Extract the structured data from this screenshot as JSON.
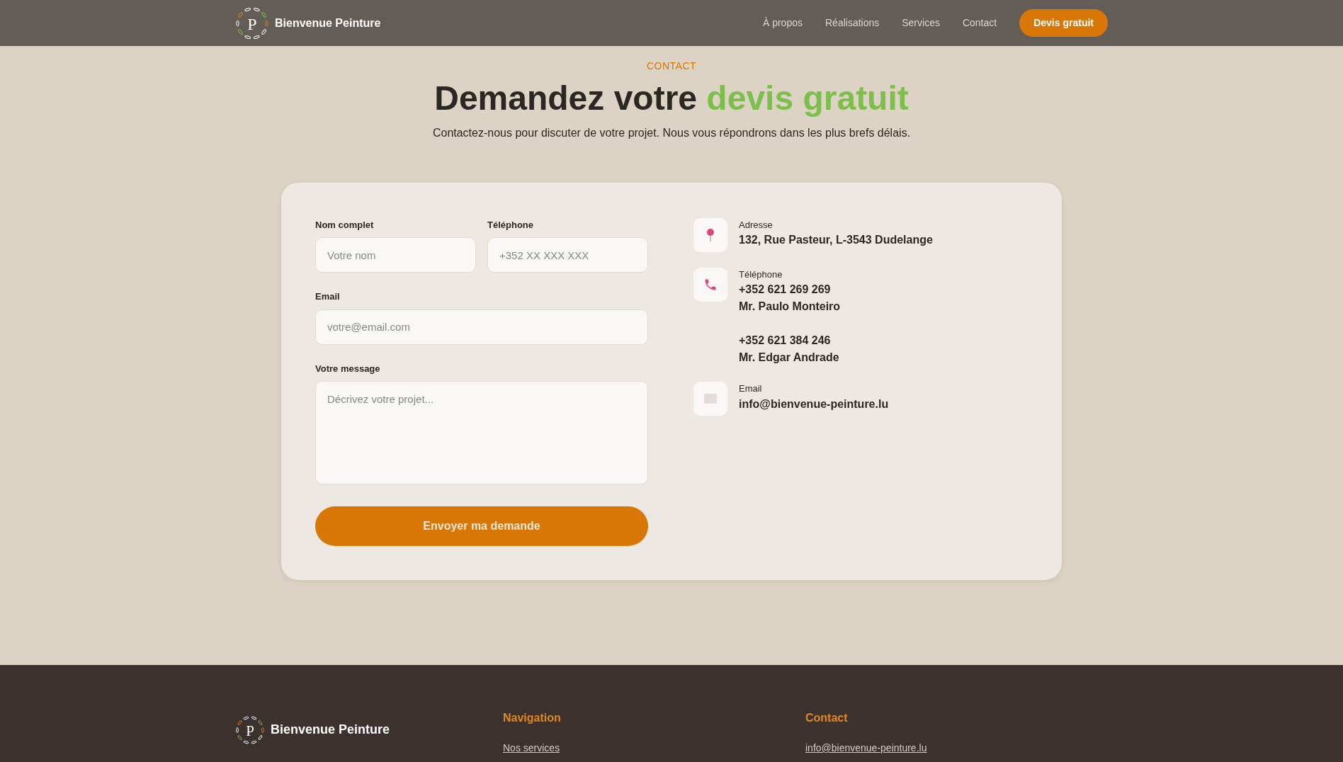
{
  "navbar": {
    "logo_letter": "P",
    "brand": "Bienvenue Peinture",
    "links": [
      "À propos",
      "Réalisations",
      "Services",
      "Contact"
    ],
    "cta": "Devis gratuit"
  },
  "section": {
    "eyebrow": "CONTACT",
    "title_start": "Demandez votre",
    "title_highlight": "devis gratuit",
    "subtitle": "Contactez-nous pour discuter de votre projet. Nous vous répondrons dans les plus brefs délais."
  },
  "form": {
    "rows": [
      [
        {
          "kind": "text",
          "label": "Nom complet",
          "placeholder": "Votre nom"
        },
        {
          "kind": "text",
          "label": "Téléphone",
          "placeholder": "+352 XX XXX XXX"
        }
      ],
      [
        {
          "kind": "text",
          "label": "Email",
          "placeholder": "votre@email.com"
        }
      ],
      [
        {
          "kind": "textarea",
          "label": "Votre message",
          "placeholder": "Décrivez votre projet..."
        }
      ]
    ],
    "submit": "Envoyer ma demande"
  },
  "contact_items": [
    {
      "kind": "address",
      "label": "Adresse",
      "entries": [
        [
          "132, Rue Pasteur, L-3543 Dudelange"
        ]
      ]
    },
    {
      "kind": "phone",
      "label": "Téléphone",
      "entries": [
        [
          "+352 621 269 269",
          "Mr. Paulo Monteiro"
        ],
        [
          "+352 621 384 246",
          "Mr. Edgar Andrade"
        ]
      ]
    },
    {
      "kind": "email",
      "label": "Email",
      "entries": [
        [
          "info@bienvenue-peinture.lu"
        ]
      ]
    }
  ],
  "footer": {
    "logo_letter": "P",
    "brand": "Bienvenue Peinture",
    "columns": [
      {
        "heading": "Navigation",
        "items": [
          "Nos services"
        ]
      },
      {
        "heading": "Contact",
        "items": [
          "info@bienvenue-peinture.lu"
        ]
      }
    ]
  }
}
